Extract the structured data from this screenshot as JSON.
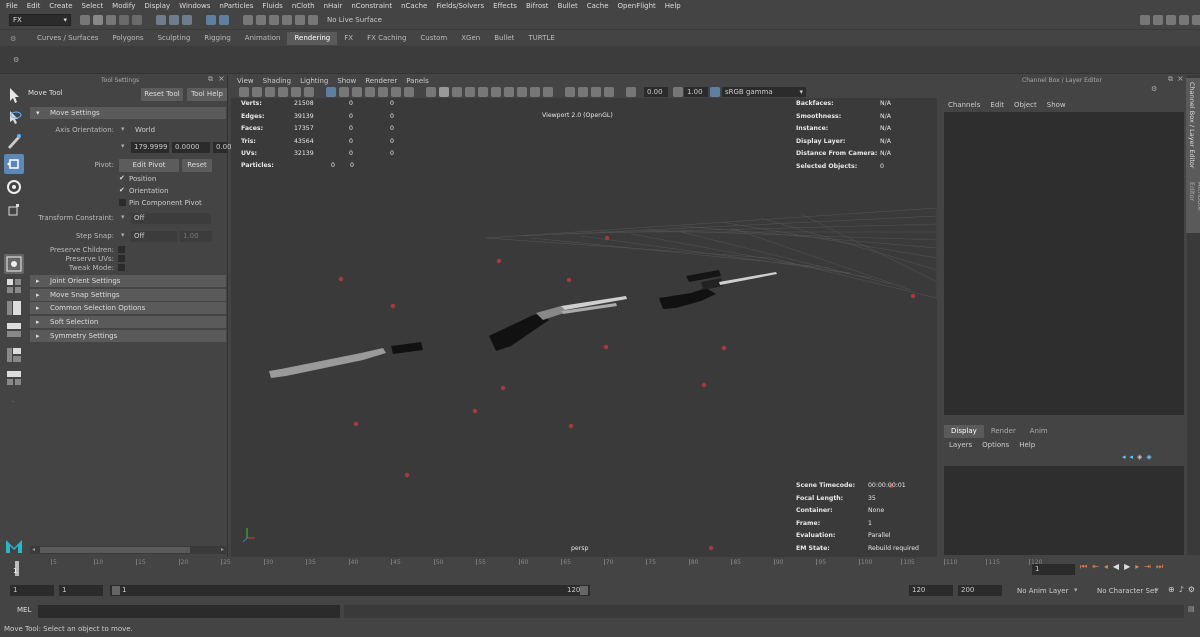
{
  "menubar": [
    "File",
    "Edit",
    "Create",
    "Select",
    "Modify",
    "Display",
    "Windows",
    "nParticles",
    "Fluids",
    "nCloth",
    "nHair",
    "nConstraint",
    "nCache",
    "Fields/Solvers",
    "Effects",
    "Bifrost",
    "Bullet",
    "Cache",
    "OpenFlight",
    "Help"
  ],
  "status": {
    "mode": "FX",
    "live_surface": "No Live Surface"
  },
  "shelf_tabs": [
    "Curves / Surfaces",
    "Polygons",
    "Sculpting",
    "Rigging",
    "Animation",
    "Rendering",
    "FX",
    "FX Caching",
    "Custom",
    "XGen",
    "Bullet",
    "TURTLE"
  ],
  "shelf_active": "Rendering",
  "tool_settings": {
    "panel_title": "Tool Settings",
    "tool_name": "Move Tool",
    "reset_tool": "Reset Tool",
    "tool_help": "Tool Help",
    "move_settings": "Move Settings",
    "axis_orientation_label": "Axis Orientation:",
    "axis_orientation_value": "World",
    "rot_x": "179.9999",
    "rot_y": "0.0000",
    "rot_z": "0.00",
    "pivot_label": "Pivot:",
    "edit_pivot": "Edit Pivot",
    "reset": "Reset",
    "position": "Position",
    "orientation": "Orientation",
    "pin_component_pivot": "Pin Component Pivot",
    "transform_constraint_label": "Transform Constraint:",
    "transform_constraint_value": "Off",
    "step_snap_label": "Step Snap:",
    "step_snap_value": "Off",
    "step_snap_amount": "1.00",
    "preserve_children": "Preserve Children:",
    "preserve_uvs": "Preserve UVs:",
    "tweak_mode": "Tweak Mode:",
    "sections": [
      "Joint Orient Settings",
      "Move Snap Settings",
      "Common Selection Options",
      "Soft Selection",
      "Symmetry Settings"
    ]
  },
  "viewport": {
    "menu": [
      "View",
      "Shading",
      "Lighting",
      "Show",
      "Renderer",
      "Panels"
    ],
    "field1": "0.00",
    "field2": "1.00",
    "color_space": "sRGB gamma",
    "renderer_label": "Viewport 2.0 (OpenGL)",
    "camera": "persp",
    "stats": [
      {
        "label": "Verts:",
        "a": "21508",
        "b": "0",
        "c": "0"
      },
      {
        "label": "Edges:",
        "a": "39139",
        "b": "0",
        "c": "0"
      },
      {
        "label": "Faces:",
        "a": "17357",
        "b": "0",
        "c": "0"
      },
      {
        "label": "Tris:",
        "a": "43564",
        "b": "0",
        "c": "0"
      },
      {
        "label": "UVs:",
        "a": "32139",
        "b": "0",
        "c": "0"
      }
    ],
    "particles": {
      "label": "Particles:",
      "b": "0",
      "c": "0"
    },
    "right_hud": [
      {
        "label": "Backfaces:",
        "value": "N/A"
      },
      {
        "label": "Smoothness:",
        "value": "N/A"
      },
      {
        "label": "Instance:",
        "value": "N/A"
      },
      {
        "label": "Display Layer:",
        "value": "N/A"
      },
      {
        "label": "Distance From Camera:",
        "value": "N/A"
      },
      {
        "label": "Selected Objects:",
        "value": "0"
      }
    ],
    "bottom_hud": [
      {
        "label": "Scene Timecode:",
        "value": "00:00:00:01"
      },
      {
        "label": "Focal Length:",
        "value": "35"
      },
      {
        "label": "Container:",
        "value": "None"
      },
      {
        "label": "Frame:",
        "value": "1"
      },
      {
        "label": "Evaluation:",
        "value": "Parallel"
      },
      {
        "label": "EM State:",
        "value": "Rebuild required"
      }
    ]
  },
  "channel_box": {
    "title": "Channel Box / Layer Editor",
    "menu": [
      "Channels",
      "Edit",
      "Object",
      "Show"
    ],
    "layer_tabs": [
      "Display",
      "Render",
      "Anim"
    ],
    "layer_menu": [
      "Layers",
      "Options",
      "Help"
    ]
  },
  "side_tabs": [
    "Channel Box / Layer Editor",
    "Attribute Editor"
  ],
  "timeline": {
    "ticks": [
      "1",
      "5",
      "10",
      "15",
      "20",
      "25",
      "30",
      "35",
      "40",
      "45",
      "50",
      "55",
      "60",
      "65",
      "70",
      "75",
      "80",
      "85",
      "90",
      "95",
      "100",
      "105",
      "110",
      "115",
      "120"
    ],
    "current": "1",
    "frame_field": "1"
  },
  "range": {
    "start": "1",
    "anim_start": "1",
    "slider_start": "1",
    "slider_end": "120",
    "end": "120",
    "anim_end": "200",
    "anim_layer": "No Anim Layer",
    "character_set": "No Character Set"
  },
  "cmdline": {
    "label": "MEL"
  },
  "help_line": "Move Tool: Select an object to move."
}
